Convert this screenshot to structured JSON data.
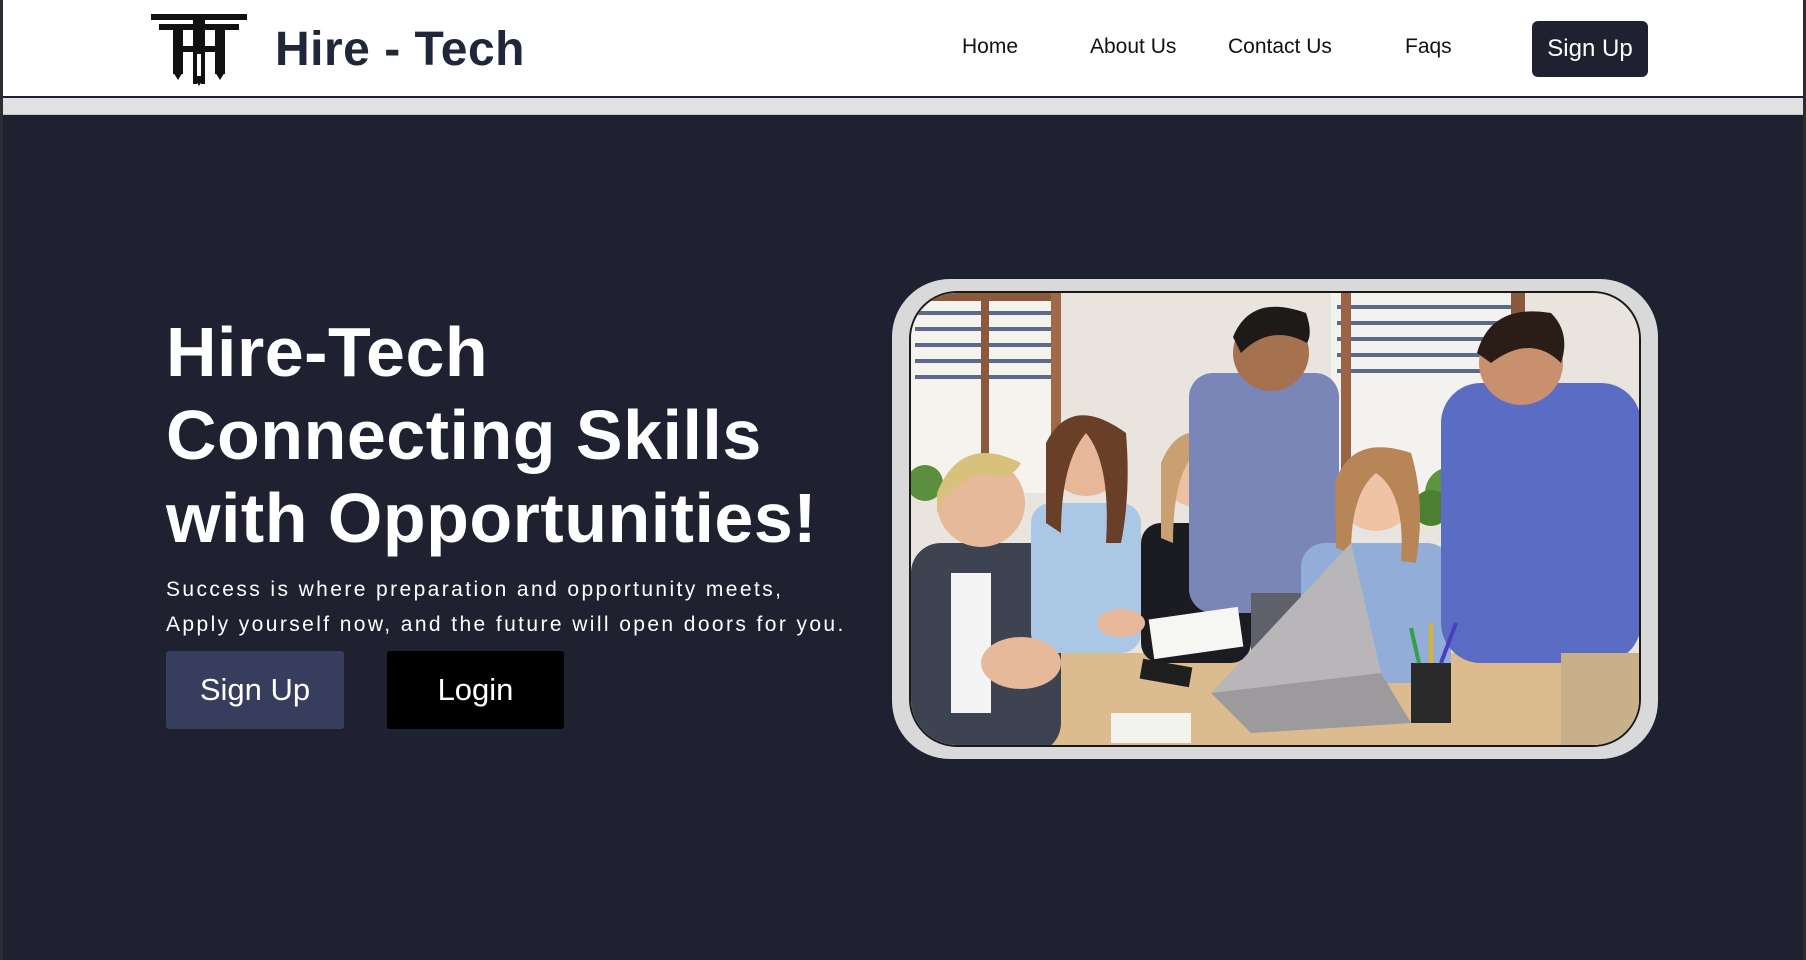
{
  "header": {
    "brand": "Hire - Tech",
    "logo_icon": "ht-monogram-logo",
    "nav": {
      "home": "Home",
      "about": "About Us",
      "contact": "Contact Us",
      "faqs": "Faqs"
    },
    "signup_label": "Sign Up"
  },
  "hero": {
    "title_line1": "Hire-Tech",
    "title_line2": "Connecting Skills",
    "title_line3": "with Opportunities!",
    "subtitle_line1": "Success is where preparation and opportunity meets,",
    "subtitle_line2": "Apply yourself now, and the future will open doors for you.",
    "signup_label": "Sign Up",
    "login_label": "Login",
    "image": "team-meeting-photo"
  },
  "colors": {
    "dark": "#1f2131",
    "signup_button": "#363d5d",
    "login_button": "#000000",
    "separator": "#e1e1e1"
  }
}
